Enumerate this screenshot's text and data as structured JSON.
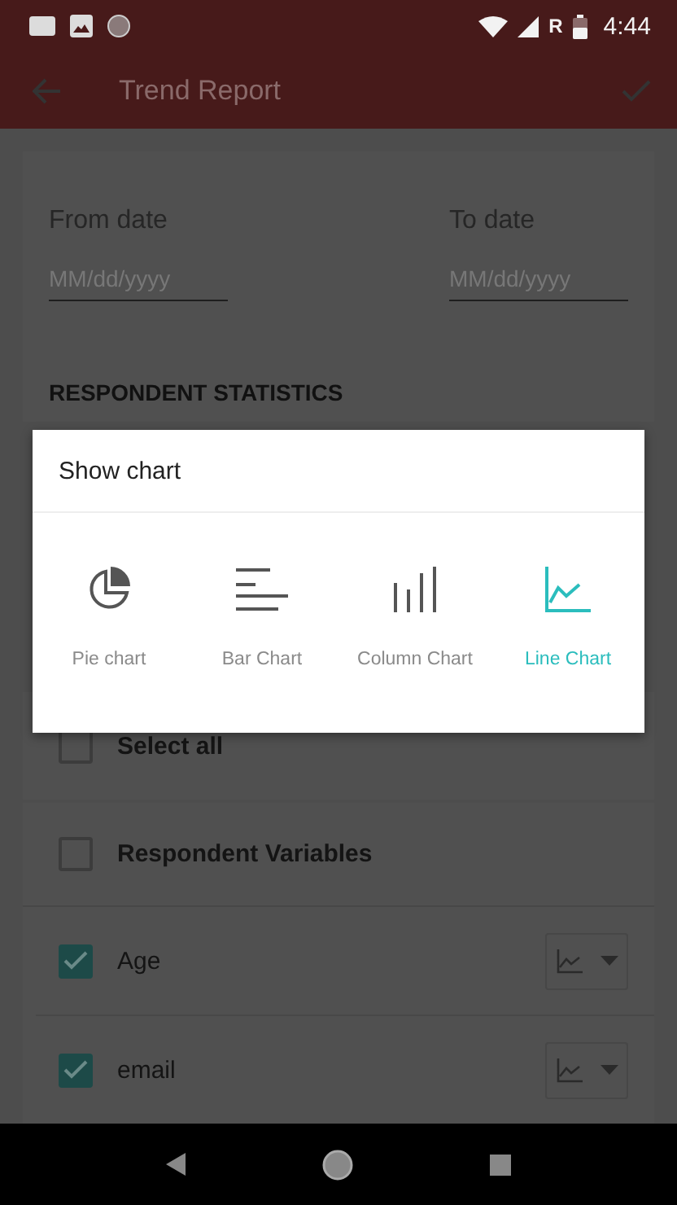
{
  "status_bar": {
    "time": "4:44",
    "network": "R"
  },
  "app_bar": {
    "title": "Trend Report"
  },
  "date_fields": [
    {
      "label": "From date",
      "placeholder": "MM/dd/yyyy"
    },
    {
      "label": "To date",
      "placeholder": "MM/dd/yyyy"
    }
  ],
  "section_title": "RESPONDENT STATISTICS",
  "select_all": {
    "label": "Select all",
    "checked": false
  },
  "group": {
    "label": "Respondent Variables",
    "checked": false
  },
  "variables": [
    {
      "label": "Age",
      "checked": true
    },
    {
      "label": "email",
      "checked": true
    }
  ],
  "dialog": {
    "title": "Show chart",
    "options": [
      {
        "kind": "pie",
        "label": "Pie chart",
        "selected": false
      },
      {
        "kind": "bar",
        "label": "Bar Chart",
        "selected": false
      },
      {
        "kind": "column",
        "label": "Column Chart",
        "selected": false
      },
      {
        "kind": "line",
        "label": "Line Chart",
        "selected": true
      }
    ]
  }
}
